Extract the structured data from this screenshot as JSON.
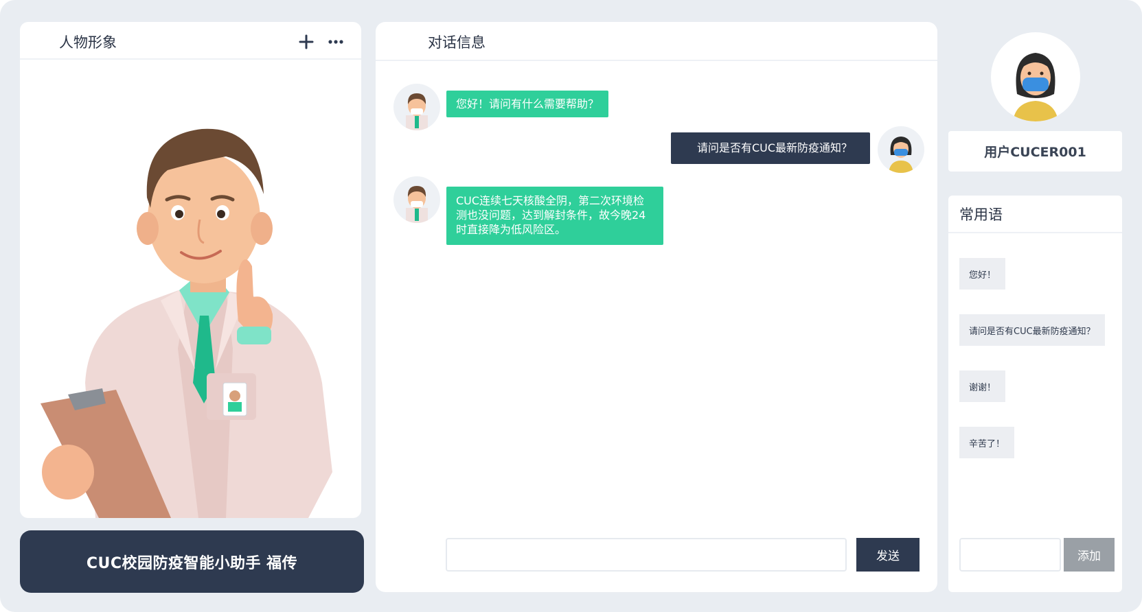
{
  "left_panel": {
    "title": "人物形象",
    "add_icon": "plus-icon",
    "more_icon": "more-dots-icon",
    "assistant_name": "CUC校园防疫智能小助手  福传"
  },
  "chat": {
    "title": "对话信息",
    "messages": [
      {
        "sender": "bot",
        "text": "您好！请问有什么需要帮助？"
      },
      {
        "sender": "user",
        "text": "请问是否有CUC最新防疫通知？"
      },
      {
        "sender": "bot",
        "text": "CUC连续七天核酸全阴，第二次环境检测也没问题，达到解封条件，故今晚24时直接降为低风险区。"
      }
    ],
    "input_placeholder": "",
    "send_label": "发送"
  },
  "user": {
    "name": "用户CUCER001"
  },
  "phrases": {
    "title": "常用语",
    "items": [
      "您好！",
      "请问是否有CUC最新防疫通知？",
      "谢谢！",
      "辛苦了！"
    ],
    "input_placeholder": "",
    "add_label": "添加"
  },
  "colors": {
    "background": "#e9edf2",
    "navy": "#2e3a50",
    "bot_bubble": "#2fcf9a",
    "add_button": "#9aa0a6"
  }
}
